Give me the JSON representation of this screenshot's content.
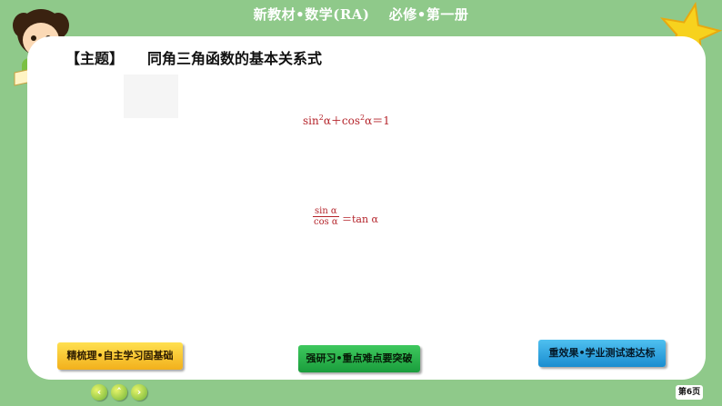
{
  "header": {
    "title": "新教材•数学(RA)　 必修•第一册"
  },
  "topic": {
    "bracket": "【主题】",
    "text": "同角三角函数的基本关系式"
  },
  "formulas": {
    "f1_sin": "sin",
    "f1_sup1": "2",
    "f1_alpha1": "α＋cos",
    "f1_sup2": "2",
    "f1_alpha2": "α＝1",
    "f2_num": "sin α",
    "f2_den": "cos α",
    "f2_rest": "＝tan α"
  },
  "nav": {
    "btn1": "精梳理•自主学习固基础",
    "btn2": "强研习•重点难点要突破",
    "btn3": "重效果•学业测试速达标",
    "prev": "‹",
    "up": "˄",
    "next": "›"
  },
  "page": {
    "number": "第6页"
  },
  "colors": {
    "background": "#8fc98a",
    "formula": "#b4232a",
    "star": "#f7d21e"
  }
}
